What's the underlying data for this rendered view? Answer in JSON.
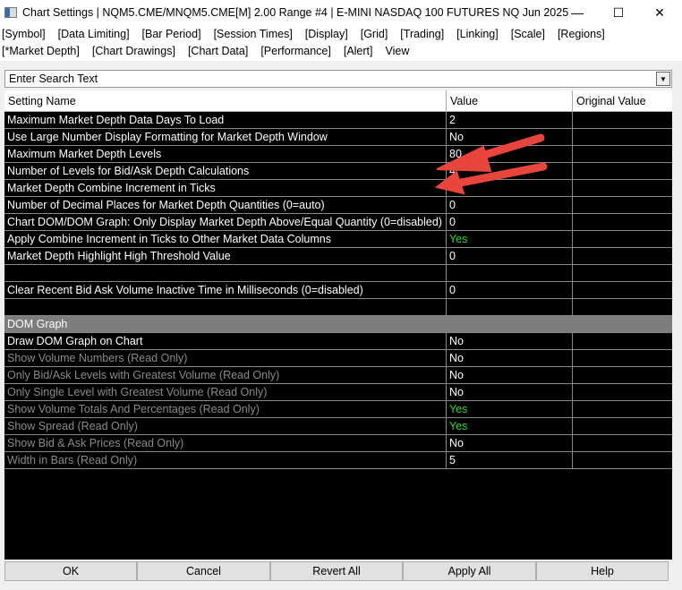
{
  "title": "Chart Settings | NQM5.CME/MNQM5.CME[M]  2.00 Range #4 | E-MINI NASDAQ 100 FUTURES NQ Jun 2025",
  "window": {
    "minimize": "—",
    "maximize": "☐",
    "close": "✕"
  },
  "menu_row1": [
    "[Symbol]",
    "[Data Limiting]",
    "[Bar Period]",
    "[Session Times]",
    "[Display]",
    "[Grid]",
    "[Trading]",
    "[Linking]",
    "[Scale]",
    "[Regions]"
  ],
  "menu_row2": [
    "[*Market Depth]",
    "[Chart Drawings]",
    "[Chart Data]",
    "[Performance]",
    "[Alert]",
    "View"
  ],
  "search": {
    "placeholder": "Enter Search Text",
    "value": "Enter Search Text"
  },
  "columns": [
    "Setting Name",
    "Value",
    "Original Value"
  ],
  "rows": [
    {
      "name": "Maximum Market Depth Data Days To Load",
      "value": "2"
    },
    {
      "name": "Use Large Number Display Formatting for Market Depth Window",
      "value": "No"
    },
    {
      "name": "Maximum Market Depth Levels",
      "value": "80"
    },
    {
      "name": "Number of Levels for Bid/Ask Depth Calculations",
      "value": "4"
    },
    {
      "name": "Market Depth Combine Increment in Ticks",
      "value": "4"
    },
    {
      "name": "Number of Decimal Places for Market Depth Quantities (0=auto)",
      "value": "0"
    },
    {
      "name": "Chart DOM/DOM Graph: Only Display Market Depth Above/Equal Quantity (0=disabled)",
      "value": "0"
    },
    {
      "name": "Apply Combine Increment in Ticks to Other Market Data Columns",
      "value": "Yes"
    },
    {
      "name": "Market Depth Highlight High Threshold Value",
      "value": "0"
    },
    {
      "name": "",
      "value": ""
    },
    {
      "name": "Clear Recent Bid Ask Volume Inactive Time in Milliseconds (0=disabled)",
      "value": "0"
    },
    {
      "name": "",
      "value": ""
    }
  ],
  "section": "DOM Graph",
  "dom_rows": [
    {
      "name": "Draw DOM Graph on Chart",
      "value": "No"
    },
    {
      "name": "Show Volume Numbers (Read Only)",
      "value": "No"
    },
    {
      "name": "Only Bid/Ask Levels with Greatest Volume (Read Only)",
      "value": "No"
    },
    {
      "name": "Only Single Level with Greatest Volume (Read Only)",
      "value": "No"
    },
    {
      "name": "Show Volume Totals And Percentages (Read Only)",
      "value": "Yes"
    },
    {
      "name": "Show Spread (Read Only)",
      "value": "Yes"
    },
    {
      "name": "Show Bid & Ask Prices (Read Only)",
      "value": "No"
    },
    {
      "name": "Width in Bars (Read Only)",
      "value": "5"
    }
  ],
  "buttons": [
    "OK",
    "Cancel",
    "Revert All",
    "Apply All",
    "Help"
  ],
  "colors": {
    "yes": "#2ed62e",
    "arrow": "#e8453c",
    "section": "#7d7d7d"
  }
}
